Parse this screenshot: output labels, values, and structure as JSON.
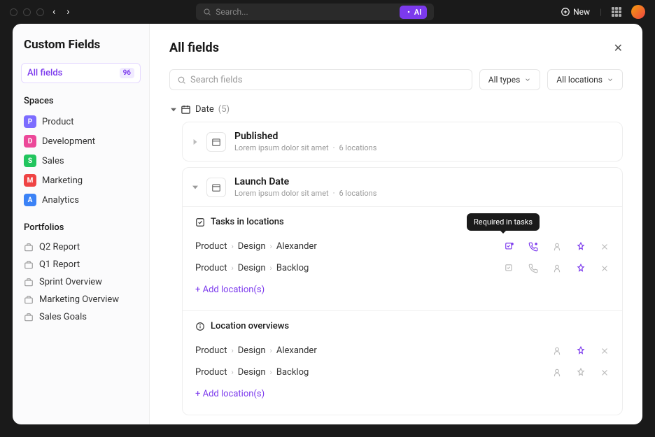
{
  "titlebar": {
    "search_placeholder": "Search...",
    "ai_label": "AI",
    "new_label": "New"
  },
  "sidebar": {
    "title": "Custom Fields",
    "all_fields": {
      "label": "All fields",
      "count": "96"
    },
    "spaces_header": "Spaces",
    "spaces": [
      {
        "letter": "P",
        "label": "Product",
        "color": "#7c6cff"
      },
      {
        "letter": "D",
        "label": "Development",
        "color": "#ec4899"
      },
      {
        "letter": "S",
        "label": "Sales",
        "color": "#22c55e"
      },
      {
        "letter": "M",
        "label": "Marketing",
        "color": "#ef4444"
      },
      {
        "letter": "A",
        "label": "Analytics",
        "color": "#3b82f6"
      }
    ],
    "portfolios_header": "Portfolios",
    "portfolios": [
      "Q2 Report",
      "Q1 Report",
      "Sprint Overview",
      "Marketing Overview",
      "Sales Goals"
    ]
  },
  "main": {
    "title": "All fields",
    "search_placeholder": "Search fields",
    "filter_types": "All types",
    "filter_locations": "All locations",
    "group": {
      "label": "Date",
      "count": "(5)"
    },
    "fields": [
      {
        "name": "Published",
        "desc": "Lorem ipsum dolor sit amet",
        "locations": "6 locations"
      },
      {
        "name": "Launch Date",
        "desc": "Lorem ipsum dolor sit amet",
        "locations": "6 locations"
      }
    ],
    "tasks_panel": {
      "title": "Tasks in locations",
      "tooltip": "Required in tasks",
      "add": "+ Add location(s)"
    },
    "overviews_panel": {
      "title": "Location overviews",
      "add": "+ Add location(s)"
    },
    "breadcrumbs": [
      [
        "Product",
        "Design",
        "Alexander"
      ],
      [
        "Product",
        "Design",
        "Backlog"
      ]
    ]
  }
}
